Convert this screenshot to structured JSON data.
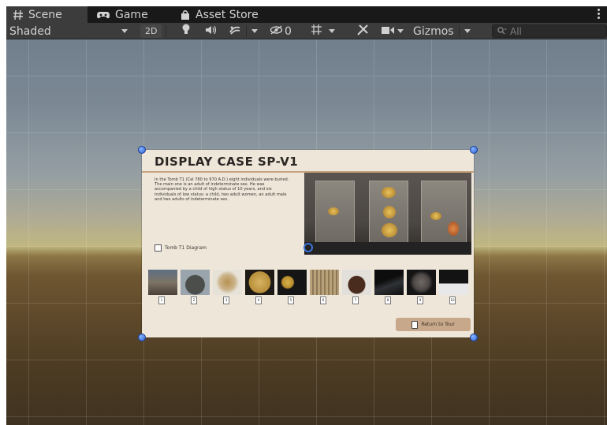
{
  "tabs": [
    {
      "label": "Scene",
      "icon": "hash-icon",
      "active": true
    },
    {
      "label": "Game",
      "icon": "gamepad-icon",
      "active": false
    },
    {
      "label": "Asset Store",
      "icon": "shopping-bag-icon",
      "active": false
    }
  ],
  "toolbar": {
    "shading_mode": "Shaded",
    "mode_2d": "2D",
    "hidden_count": "0",
    "gizmos_label": "Gizmos",
    "search_placeholder": "All"
  },
  "canvas": {
    "title": "DISPLAY CASE SP-V1",
    "description": "In the Tomb T1 (Cal 780 to 970 A.D.) eight individuals were buried. The main one is an adult of indeterminate sex. He was accompanied by a child of high status of 10 years, and six individuals of low status: a child, two adult women, an adult male and two adults of indeterminate sex.",
    "diagram_link": "Tomb T1 Diagram",
    "return_label": "Return to Tour",
    "thumbnails": [
      {
        "number": "1"
      },
      {
        "number": "2"
      },
      {
        "number": "3"
      },
      {
        "number": "4"
      },
      {
        "number": "5"
      },
      {
        "number": "6"
      },
      {
        "number": "7"
      },
      {
        "number": "8"
      },
      {
        "number": "9"
      },
      {
        "number": "10"
      }
    ]
  },
  "colors": {
    "accent_handle": "#2a62d8",
    "panel_bg": "#efe6da",
    "title_underline": "#c7a37f",
    "button_bg": "#c8a88a"
  }
}
